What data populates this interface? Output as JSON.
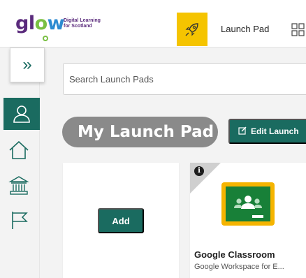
{
  "header": {
    "logo_word": {
      "g": "gl",
      "o": "o",
      "w": "w"
    },
    "logo_tagline": [
      "Digital Learning",
      "for Scotland"
    ],
    "launch_pad_label": "Launch Pad"
  },
  "sidebar": {
    "expand_glyph": "»",
    "items": [
      {
        "icon": "user-icon",
        "active": true
      },
      {
        "icon": "home-icon",
        "active": false
      },
      {
        "icon": "institution-icon",
        "active": false
      },
      {
        "icon": "flag-icon",
        "active": false
      }
    ]
  },
  "search": {
    "placeholder": "Search Launch Pads",
    "value": ""
  },
  "main": {
    "title": "My Launch Pad",
    "edit_label": "Edit Launch",
    "add_label": "Add"
  },
  "apps": [
    {
      "name": "Google Classroom",
      "subtitle": "Google Workspace for E...",
      "icon": "google-classroom-icon"
    }
  ],
  "colors": {
    "brand_teal": "#1a6b60",
    "launch_yellow": "#f5c400",
    "pill_grey": "#8a8a8a",
    "logo_purple": "#5a2a7c"
  }
}
